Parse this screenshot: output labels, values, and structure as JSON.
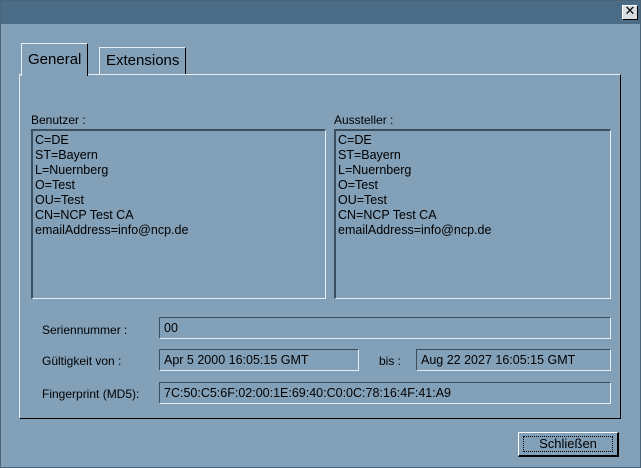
{
  "window": {
    "close_glyph": "✕"
  },
  "tabs": [
    {
      "label": "General",
      "active": true
    },
    {
      "label": "Extensions",
      "active": false
    }
  ],
  "subject": {
    "label": "Benutzer :",
    "lines": [
      "C=DE",
      "ST=Bayern",
      "L=Nuernberg",
      "O=Test",
      "OU=Test",
      "CN=NCP Test CA",
      "emailAddress=info@ncp.de"
    ]
  },
  "issuer": {
    "label": "Aussteller :",
    "lines": [
      "C=DE",
      "ST=Bayern",
      "L=Nuernberg",
      "O=Test",
      "OU=Test",
      "CN=NCP Test CA",
      "emailAddress=info@ncp.de"
    ]
  },
  "serial": {
    "label": "Seriennummer :",
    "value": "00"
  },
  "validity": {
    "label": "Gültigkeit von :",
    "from": "Apr  5 2000 16:05:15  GMT",
    "to_label": "bis :",
    "to": "Aug 22 2027 16:05:15  GMT"
  },
  "fingerprint": {
    "label": "Fingerprint (MD5):",
    "value": "7C:50:C5:6F:02:00:1E:69:40:C0:0C:78:16:4F:41:A9"
  },
  "buttons": {
    "close_label": "Schließen"
  },
  "colors": {
    "background": "#82a0b8",
    "titlebar": "#4a6c86"
  }
}
